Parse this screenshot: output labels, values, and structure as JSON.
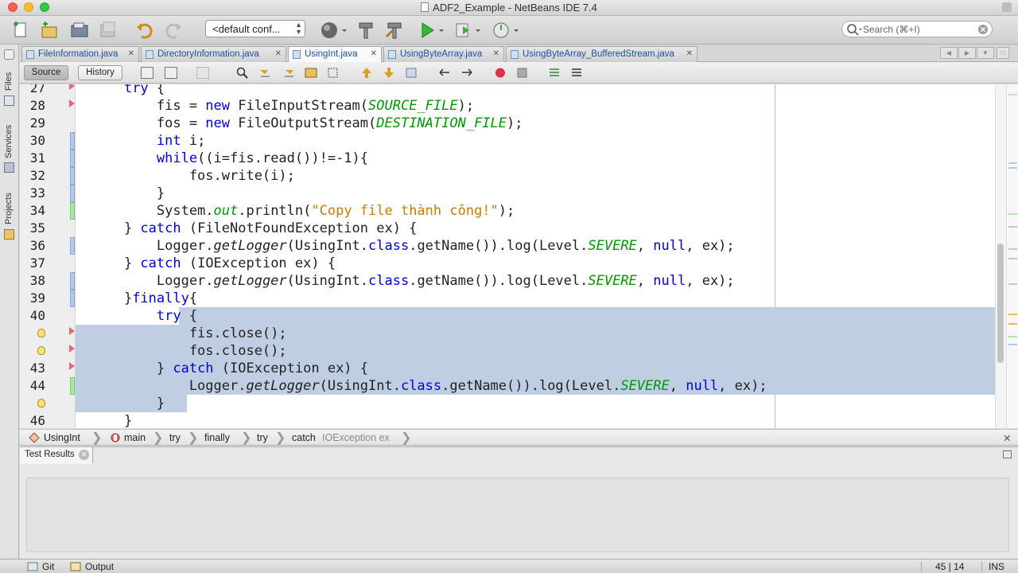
{
  "window": {
    "title": "ADF2_Example - NetBeans IDE 7.4"
  },
  "toolbar": {
    "config_value": "<default conf...",
    "search_placeholder": "Search (⌘+I)"
  },
  "left_strip": {
    "files": "Files",
    "services": "Services",
    "projects": "Projects"
  },
  "tabs": [
    {
      "label": "FileInformation.java"
    },
    {
      "label": "DirectoryInformation.java"
    },
    {
      "label": "UsingInt.java",
      "active": true
    },
    {
      "label": "UsingByteArray.java"
    },
    {
      "label": "UsingByteArray_BufferedStream.java"
    }
  ],
  "editor_toolbar": {
    "source_label": "Source",
    "history_label": "History"
  },
  "code_lines": [
    {
      "n": "27",
      "text": "    try {"
    },
    {
      "n": "28",
      "text": "        fis = new FileInputStream(SOURCE_FILE);"
    },
    {
      "n": "29",
      "text": "        fos = new FileOutputStream(DESTINATION_FILE);"
    },
    {
      "n": "30",
      "text": "        int i;"
    },
    {
      "n": "31",
      "text": "        while((i=fis.read())!=-1){"
    },
    {
      "n": "32",
      "text": "            fos.write(i);"
    },
    {
      "n": "33",
      "text": "        }"
    },
    {
      "n": "34",
      "text": "        System.out.println(\"Copy file thành công!\");"
    },
    {
      "n": "35",
      "text": "    } catch (FileNotFoundException ex) {"
    },
    {
      "n": "36",
      "text": "        Logger.getLogger(UsingInt.class.getName()).log(Level.SEVERE, null, ex);"
    },
    {
      "n": "37",
      "text": "    } catch (IOException ex) {"
    },
    {
      "n": "38",
      "text": "        Logger.getLogger(UsingInt.class.getName()).log(Level.SEVERE, null, ex);"
    },
    {
      "n": "39",
      "text": "    }finally{"
    },
    {
      "n": "40",
      "text": "        try {"
    },
    {
      "n": "",
      "text": "            fis.close();"
    },
    {
      "n": "",
      "text": "            fos.close();"
    },
    {
      "n": "43",
      "text": "        } catch (IOException ex) {"
    },
    {
      "n": "44",
      "text": "            Logger.getLogger(UsingInt.class.getName()).log(Level.SEVERE, null, ex);"
    },
    {
      "n": "",
      "text": "        }"
    },
    {
      "n": "46",
      "text": "    }"
    }
  ],
  "breadcrumbs": {
    "class_name": "UsingInt",
    "method": "main",
    "try1": "try",
    "finally": "finally",
    "try2": "try",
    "catch": "catch",
    "catch_detail": "IOException ex"
  },
  "test_panel": {
    "tab_label": "Test Results"
  },
  "status_bar": {
    "git": "Git",
    "output": "Output",
    "position": "45 | 14",
    "mode": "INS"
  },
  "colors": {
    "keyword": "#0000e6",
    "string": "#ce7b00",
    "static_field": "#009900",
    "selection": "#c0cee4"
  }
}
